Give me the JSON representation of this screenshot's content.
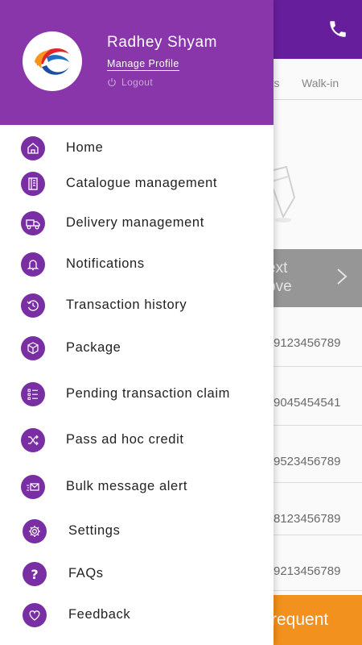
{
  "background": {
    "tabs": [
      "ers",
      "Walk-in"
    ],
    "banner_lines": [
      "ext",
      "ove"
    ],
    "phone_numbers": [
      "9123456789",
      "9045454541",
      "9523456789",
      "8123456789",
      "9213456789"
    ],
    "cta_label": "requent"
  },
  "drawer": {
    "profile": {
      "name": "Radhey Shyam",
      "manage_profile_label": "Manage Profile",
      "logout_label": "Logout"
    },
    "menu_items": [
      {
        "label": "Home",
        "icon": "home-icon"
      },
      {
        "label": "Catalogue management",
        "icon": "catalogue-icon"
      },
      {
        "label": "Delivery management",
        "icon": "delivery-icon"
      },
      {
        "label": "Notifications",
        "icon": "bell-icon"
      },
      {
        "label": "Transaction history",
        "icon": "history-icon"
      },
      {
        "label": "Package",
        "icon": "package-icon"
      },
      {
        "label": "Pending transaction claim",
        "icon": "checklist-icon"
      },
      {
        "label": "Pass ad hoc credit",
        "icon": "shuffle-icon"
      },
      {
        "label": "Bulk message alert",
        "icon": "send-mail-icon"
      },
      {
        "label": "Settings",
        "icon": "gear-icon"
      },
      {
        "label": "FAQs",
        "icon": "question-icon"
      },
      {
        "label": "Feedback",
        "icon": "heart-icon"
      }
    ]
  },
  "colors": {
    "header_purple": "#8a36ab",
    "icon_purple": "#7a2ea3",
    "topbar_purple": "#6a1fa0",
    "cta_orange": "#f7941e"
  }
}
